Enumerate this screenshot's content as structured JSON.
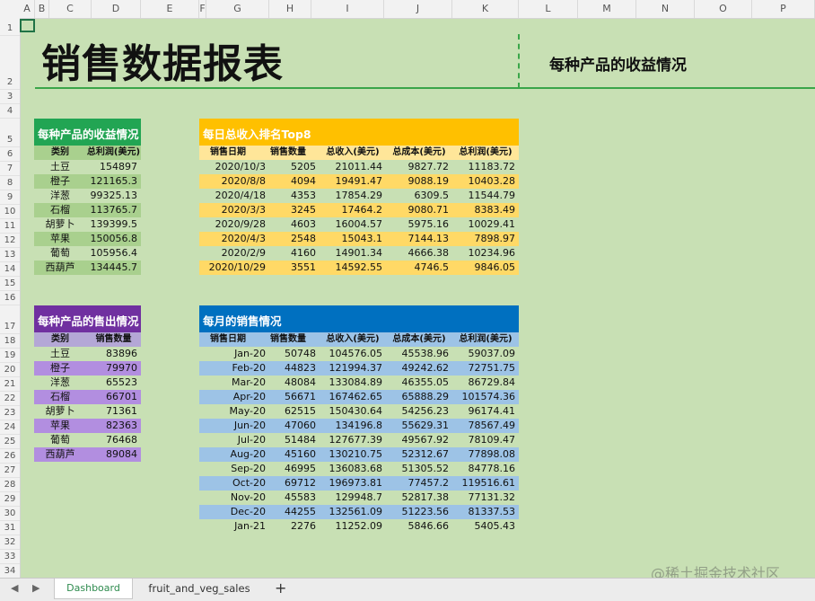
{
  "columns": [
    "A",
    "B",
    "C",
    "D",
    "E",
    "F",
    "G",
    "H",
    "I",
    "J",
    "K",
    "L",
    "M",
    "N",
    "O",
    "P"
  ],
  "rows": [
    "1",
    "2",
    "3",
    "4",
    "5",
    "6",
    "7",
    "8",
    "9",
    "10",
    "11",
    "12",
    "13",
    "14",
    "15",
    "16",
    "17",
    "18",
    "19",
    "20",
    "21",
    "22",
    "23",
    "24",
    "25",
    "26",
    "27",
    "28",
    "29",
    "30",
    "31",
    "32",
    "33",
    "34"
  ],
  "title": "销售数据报表",
  "subtitle": "每种产品的收益情况",
  "colors": {
    "green": "#22a553",
    "orange": "#ffc000",
    "purple": "#7030a0",
    "blue": "#0070c0",
    "sheet_bg": "#c8e0b4"
  },
  "revenue": {
    "title": "每种产品的收益情况",
    "headers": [
      "类别",
      "总利润(美元)"
    ],
    "rows": [
      [
        "土豆",
        "154897"
      ],
      [
        "橙子",
        "121165.3"
      ],
      [
        "洋葱",
        "99325.13"
      ],
      [
        "石榴",
        "113765.7"
      ],
      [
        "胡萝卜",
        "139399.5"
      ],
      [
        "苹果",
        "150056.8"
      ],
      [
        "葡萄",
        "105956.4"
      ],
      [
        "西葫芦",
        "134445.7"
      ]
    ]
  },
  "top8": {
    "title": "每日总收入排名Top8",
    "headers": [
      "销售日期",
      "销售数量",
      "总收入(美元)",
      "总成本(美元)",
      "总利润(美元)"
    ],
    "rows": [
      [
        "2020/10/3",
        "5205",
        "21011.44",
        "9827.72",
        "11183.72"
      ],
      [
        "2020/8/8",
        "4094",
        "19491.47",
        "9088.19",
        "10403.28"
      ],
      [
        "2020/4/18",
        "4353",
        "17854.29",
        "6309.5",
        "11544.79"
      ],
      [
        "2020/3/3",
        "3245",
        "17464.2",
        "9080.71",
        "8383.49"
      ],
      [
        "2020/9/28",
        "4603",
        "16004.57",
        "5975.16",
        "10029.41"
      ],
      [
        "2020/4/3",
        "2548",
        "15043.1",
        "7144.13",
        "7898.97"
      ],
      [
        "2020/2/9",
        "4160",
        "14901.34",
        "4666.38",
        "10234.96"
      ],
      [
        "2020/10/29",
        "3551",
        "14592.55",
        "4746.5",
        "9846.05"
      ]
    ]
  },
  "sales": {
    "title": "每种产品的售出情况",
    "headers": [
      "类别",
      "销售数量"
    ],
    "rows": [
      [
        "土豆",
        "83896"
      ],
      [
        "橙子",
        "79970"
      ],
      [
        "洋葱",
        "65523"
      ],
      [
        "石榴",
        "66701"
      ],
      [
        "胡萝卜",
        "71361"
      ],
      [
        "苹果",
        "82363"
      ],
      [
        "葡萄",
        "76468"
      ],
      [
        "西葫芦",
        "89084"
      ]
    ]
  },
  "monthly": {
    "title": "每月的销售情况",
    "headers": [
      "销售日期",
      "销售数量",
      "总收入(美元)",
      "总成本(美元)",
      "总利润(美元)"
    ],
    "rows": [
      [
        "Jan-20",
        "50748",
        "104576.05",
        "45538.96",
        "59037.09"
      ],
      [
        "Feb-20",
        "44823",
        "121994.37",
        "49242.62",
        "72751.75"
      ],
      [
        "Mar-20",
        "48084",
        "133084.89",
        "46355.05",
        "86729.84"
      ],
      [
        "Apr-20",
        "56671",
        "167462.65",
        "65888.29",
        "101574.36"
      ],
      [
        "May-20",
        "62515",
        "150430.64",
        "54256.23",
        "96174.41"
      ],
      [
        "Jun-20",
        "47060",
        "134196.8",
        "55629.31",
        "78567.49"
      ],
      [
        "Jul-20",
        "51484",
        "127677.39",
        "49567.92",
        "78109.47"
      ],
      [
        "Aug-20",
        "45160",
        "130210.75",
        "52312.67",
        "77898.08"
      ],
      [
        "Sep-20",
        "46995",
        "136083.68",
        "51305.52",
        "84778.16"
      ],
      [
        "Oct-20",
        "69712",
        "196973.81",
        "77457.2",
        "119516.61"
      ],
      [
        "Nov-20",
        "45583",
        "129948.7",
        "52817.38",
        "77131.32"
      ],
      [
        "Dec-20",
        "44255",
        "132561.09",
        "51223.56",
        "81337.53"
      ],
      [
        "Jan-21",
        "2276",
        "11252.09",
        "5846.66",
        "5405.43"
      ]
    ]
  },
  "tabs": [
    "Dashboard",
    "fruit_and_veg_sales"
  ],
  "add_sheet": "+",
  "nav": {
    "prev": "◀",
    "next": "▶"
  },
  "watermark": "@稀土掘金技术社区"
}
